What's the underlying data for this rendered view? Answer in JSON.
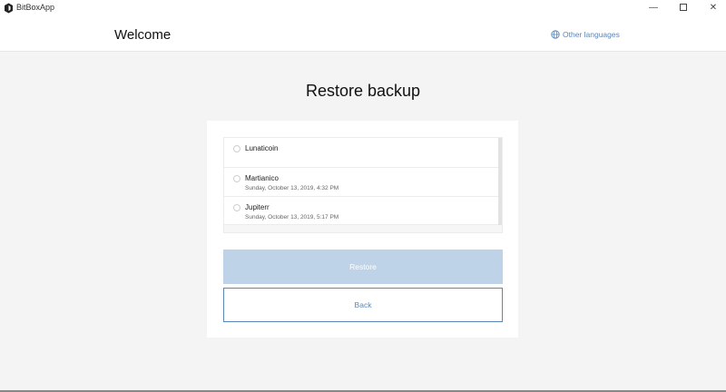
{
  "window": {
    "title": "BitBoxApp"
  },
  "header": {
    "title": "Welcome",
    "language_link": "Other languages"
  },
  "main": {
    "title": "Restore backup",
    "backups": [
      {
        "name": "Lunaticoin",
        "date": ""
      },
      {
        "name": "Martianico",
        "date": "Sunday, October 13, 2019, 4:32 PM"
      },
      {
        "name": "Jupiterr",
        "date": "Sunday, October 13, 2019, 5:17 PM"
      }
    ],
    "restore_label": "Restore",
    "back_label": "Back"
  },
  "colors": {
    "accent": "#5a86b8",
    "disabled_button": "#bed3e7",
    "background": "#f4f4f4"
  }
}
